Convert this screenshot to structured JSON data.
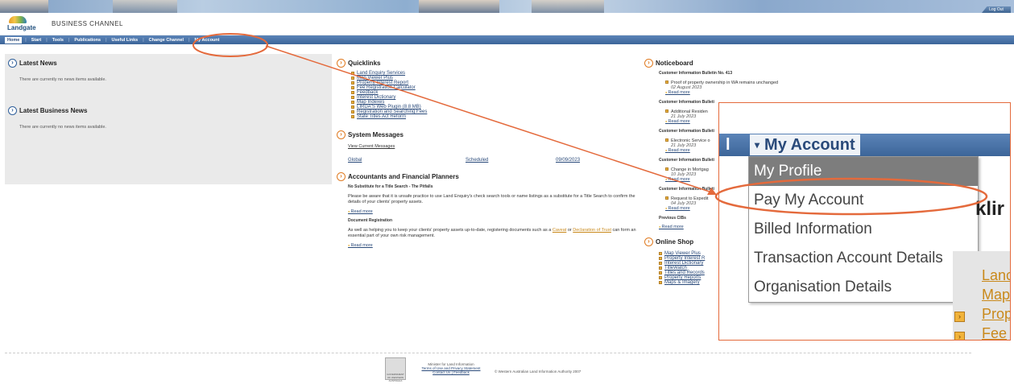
{
  "header": {
    "logout_label": "Log Out",
    "logo_text": "Landgate",
    "channel": "BUSINESS CHANNEL"
  },
  "nav": {
    "items": [
      "Home",
      "Start",
      "Tools",
      "Publications",
      "Useful Links",
      "Change Channel",
      "My Account"
    ]
  },
  "latest_news": {
    "title": "Latest News",
    "text": "There are currently no news items available."
  },
  "latest_business_news": {
    "title": "Latest Business News",
    "text": "There are currently no news items available."
  },
  "quicklinks": {
    "title": "Quicklinks",
    "items": [
      "Land Enquiry Services",
      "Map Viewer Plus",
      "Property Interest Report",
      "Fee Registration Calculator",
      "Feedback",
      "Interest Dictionary",
      "Map Indexes",
      "LIRDA'S Web Plugin (8.8 MB)",
      "Registration and Searching Fees",
      "State Titles Act Reform"
    ]
  },
  "system_messages": {
    "title": "System Messages",
    "view_link": "View Current Messages",
    "row": {
      "scope": "Global",
      "type": "Scheduled",
      "date": "09/09/2023"
    }
  },
  "accountants": {
    "title": "Accountants and Financial Planners",
    "h1": "No Substitute for a Title Search - The Pitfalls",
    "p1": "Please be aware that it is unsafe practice to use Land Enquiry's check search tools or name listings as a substitute for a Title Search to confirm the details of your clients' property assets.",
    "read_more": "Read more",
    "h2": "Document Registration",
    "p2a": "As well as helping you to keep your clients' property assets up-to-date, registering documents such as a",
    "caveat": "Caveat",
    "or": "or",
    "declaration": "Declaration of Trust",
    "p2b": "can form an essential part of your own risk management."
  },
  "noticeboard": {
    "title": "Noticeboard",
    "bulletin_label": "Customer Information Bulletin No. 413",
    "items": [
      {
        "text": "Proof of property ownership in WA remains unchanged",
        "date": "02 August 2023"
      },
      {
        "text": "Additional Residen",
        "date": "21 July 2023"
      },
      {
        "text": "Electronic Service o",
        "date": "21 July 2023"
      },
      {
        "text": "Change in Mortgag",
        "date": "10 July 2023"
      },
      {
        "text": "Request to Expedit",
        "date": "04 July 2023"
      }
    ],
    "bulletin_short": "Customer Information Bulleti",
    "read_more": "Read more",
    "previous": "Previous CIBs"
  },
  "online_shop": {
    "title": "Online Shop",
    "items": [
      "Map Viewer Plus",
      "Property Interest R",
      "Interest Dictionary",
      "TitleWatch",
      "Titles and Records",
      "Property Reports",
      "Maps & Imagery"
    ]
  },
  "zoom": {
    "label": "l",
    "my_account": "My Account",
    "menu": [
      "My Profile",
      "Pay My Account",
      "Billed Information",
      "Transaction Account Details",
      "Organisation Details"
    ],
    "side_heading": "klir",
    "side_links": [
      "Lanc",
      "Map",
      "Prop",
      "Fee"
    ]
  },
  "footer": {
    "ministry": "Minister for Land Information",
    "terms": "Terms of Use and Privacy Statement",
    "contact": "Contact Us | Feedback",
    "copyright": "© Western Australian Land Information Authority 2007",
    "govt": "GOVERNMENT OF WESTERN AUSTRALIA"
  },
  "colors": {
    "nav": "#3c6599",
    "accent": "#e07b22",
    "annotation": "#e46a3c"
  }
}
